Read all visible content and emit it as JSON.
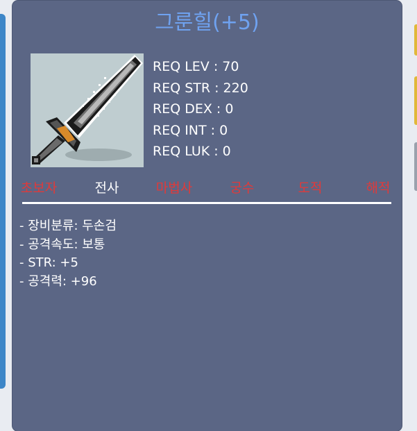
{
  "item": {
    "name": "그룬힐(+5)",
    "icon": "two-handed-sword-icon"
  },
  "requirements": [
    "REQ LEV : 70",
    "REQ STR : 220",
    "REQ DEX : 0",
    "REQ INT : 0",
    "REQ LUK : 0"
  ],
  "classes": [
    {
      "label": "초보자",
      "enabled": false
    },
    {
      "label": "전사",
      "enabled": true
    },
    {
      "label": "마법사",
      "enabled": false
    },
    {
      "label": "궁수",
      "enabled": false
    },
    {
      "label": "도적",
      "enabled": false
    },
    {
      "label": "해적",
      "enabled": false
    }
  ],
  "stats": [
    "- 장비분류: 두손검",
    "- 공격속도: 보통",
    "- STR: +5",
    "- 공격력: +96"
  ],
  "colors": {
    "panel": "#5b6685",
    "title": "#6fa2f0",
    "class_enabled": "#ffffff",
    "class_disabled": "#e03a3a"
  }
}
